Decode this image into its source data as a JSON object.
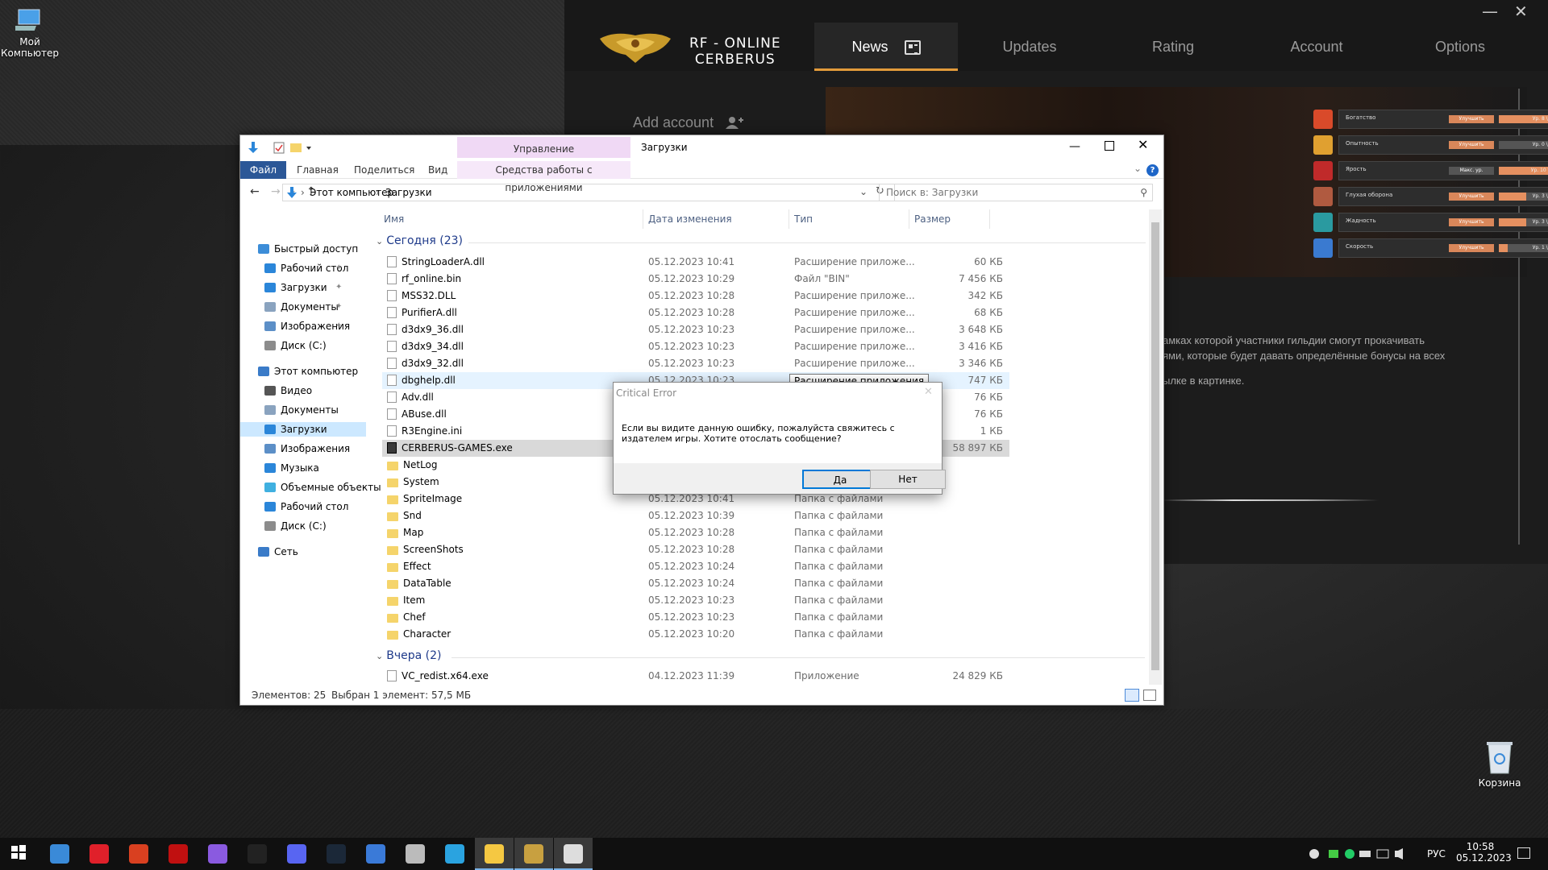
{
  "desktop": {
    "my_computer_label": "Мой Компьютер",
    "recycle_bin_label": "Корзина"
  },
  "launcher": {
    "brand_line1": "RF - ONLINE",
    "brand_line2": "CERBERUS",
    "tabs": [
      {
        "label": "News",
        "active": true
      },
      {
        "label": "Updates",
        "active": false
      },
      {
        "label": "Rating",
        "active": false
      },
      {
        "label": "Account",
        "active": false
      },
      {
        "label": "Options",
        "active": false
      }
    ],
    "minimize": "—",
    "close": "✕",
    "add_account": "Add account",
    "news_lines": [
      "амках которой участники гильдии смогут прокачивать",
      "ями, которые будет давать определённые бонусы на всех",
      "",
      "ылке в картинке."
    ],
    "stats": [
      {
        "name": "Богатство",
        "btn": "Улучшить",
        "level": "Ур. 8 \\ 10",
        "progress": 0.8,
        "color": "#d94a2a"
      },
      {
        "name": "Опытность",
        "btn": "Улучшить",
        "level": "Ур. 0 \\ 10",
        "progress": 0.0,
        "color": "#e0a030"
      },
      {
        "name": "Ярость",
        "btn": "Макс. ур.",
        "level": "Ур. 10 \\ 10",
        "progress": 1.0,
        "color": "#c02a2a"
      },
      {
        "name": "Глухая оборона",
        "btn": "Улучшить",
        "level": "Ур. 3 \\ 10",
        "progress": 0.3,
        "color": "#b05a40"
      },
      {
        "name": "Жадность",
        "btn": "Улучшить",
        "level": "Ур. 3 \\ 10",
        "progress": 0.3,
        "color": "#2a9aa0"
      },
      {
        "name": "Скорость",
        "btn": "Улучшить",
        "level": "Ур. 1 \\ 10",
        "progress": 0.1,
        "color": "#3a7ad0"
      }
    ]
  },
  "explorer": {
    "title": "Загрузки",
    "manage_tab": "Управление",
    "ribbon_tabs": [
      "Файл",
      "Главная",
      "Поделиться",
      "Вид",
      "Средства работы с приложениями"
    ],
    "address": [
      "Этот компьютер",
      "Загрузки"
    ],
    "search_placeholder": "Поиск в: Загрузки",
    "nav": [
      {
        "label": "Быстрый доступ",
        "color": "#3c8dd8",
        "indent": 0
      },
      {
        "label": "Рабочий стол",
        "color": "#2b86d9",
        "indent": 1,
        "pin": true
      },
      {
        "label": "Загрузки",
        "color": "#2b86d9",
        "indent": 1,
        "pin": true
      },
      {
        "label": "Документы",
        "color": "#8aa3bf",
        "indent": 1,
        "pin": true
      },
      {
        "label": "Изображения",
        "color": "#5c8fc7",
        "indent": 1,
        "pin": true
      },
      {
        "label": "Диск (C:)",
        "color": "#8c8c8c",
        "indent": 1
      },
      {
        "label": "Этот компьютер",
        "color": "#3a7bc8",
        "indent": 0
      },
      {
        "label": "Видео",
        "color": "#555",
        "indent": 1
      },
      {
        "label": "Документы",
        "color": "#8aa3bf",
        "indent": 1
      },
      {
        "label": "Загрузки",
        "color": "#2b86d9",
        "indent": 1,
        "selected": true
      },
      {
        "label": "Изображения",
        "color": "#5c8fc7",
        "indent": 1
      },
      {
        "label": "Музыка",
        "color": "#2b86d9",
        "indent": 1
      },
      {
        "label": "Объемные объекты",
        "color": "#40b0e0",
        "indent": 1
      },
      {
        "label": "Рабочий стол",
        "color": "#2b86d9",
        "indent": 1
      },
      {
        "label": "Диск (C:)",
        "color": "#8c8c8c",
        "indent": 1
      },
      {
        "label": "Сеть",
        "color": "#3a7bc8",
        "indent": 0
      }
    ],
    "columns": [
      "Имя",
      "Дата изменения",
      "Тип",
      "Размер"
    ],
    "group_today": "Сегодня (23)",
    "group_yesterday": "Вчера (2)",
    "files": [
      {
        "name": "StringLoaderA.dll",
        "date": "05.12.2023 10:41",
        "type": "Расширение приложе...",
        "size": "60 КБ",
        "icon": "dll"
      },
      {
        "name": "rf_online.bin",
        "date": "05.12.2023 10:29",
        "type": "Файл \"BIN\"",
        "size": "7 456 КБ",
        "icon": "bin"
      },
      {
        "name": "MSS32.DLL",
        "date": "05.12.2023 10:28",
        "type": "Расширение приложе...",
        "size": "342 КБ",
        "icon": "dll"
      },
      {
        "name": "PurifierA.dll",
        "date": "05.12.2023 10:28",
        "type": "Расширение приложе...",
        "size": "68 КБ",
        "icon": "dll"
      },
      {
        "name": "d3dx9_36.dll",
        "date": "05.12.2023 10:23",
        "type": "Расширение приложе...",
        "size": "3 648 КБ",
        "icon": "dll"
      },
      {
        "name": "d3dx9_34.dll",
        "date": "05.12.2023 10:23",
        "type": "Расширение приложе...",
        "size": "3 416 КБ",
        "icon": "dll"
      },
      {
        "name": "d3dx9_32.dll",
        "date": "05.12.2023 10:23",
        "type": "Расширение приложе...",
        "size": "3 346 КБ",
        "icon": "dll"
      },
      {
        "name": "dbghelp.dll",
        "date": "05.12.2023 10:23",
        "type": "",
        "size": "747 КБ",
        "icon": "dll",
        "hover": true
      },
      {
        "name": "Adv.dll",
        "date": "",
        "type": "",
        "size": "76 КБ",
        "icon": "dll"
      },
      {
        "name": "ABuse.dll",
        "date": "",
        "type": "",
        "size": "76 КБ",
        "icon": "dll"
      },
      {
        "name": "R3Engine.ini",
        "date": "",
        "type": "",
        "size": "1 КБ",
        "icon": "bin"
      },
      {
        "name": "CERBERUS-GAMES.exe",
        "date": "",
        "type": "",
        "size": "58 897 КБ",
        "icon": "exe",
        "selected": true
      },
      {
        "name": "NetLog",
        "date": "",
        "type": "",
        "size": "",
        "icon": "folder"
      },
      {
        "name": "System",
        "date": "",
        "type": "",
        "size": "",
        "icon": "folder"
      },
      {
        "name": "SpriteImage",
        "date": "05.12.2023 10:41",
        "type": "Папка с файлами",
        "size": "",
        "icon": "folder"
      },
      {
        "name": "Snd",
        "date": "05.12.2023 10:39",
        "type": "Папка с файлами",
        "size": "",
        "icon": "folder"
      },
      {
        "name": "Map",
        "date": "05.12.2023 10:28",
        "type": "Папка с файлами",
        "size": "",
        "icon": "folder"
      },
      {
        "name": "ScreenShots",
        "date": "05.12.2023 10:28",
        "type": "Папка с файлами",
        "size": "",
        "icon": "folder"
      },
      {
        "name": "Effect",
        "date": "05.12.2023 10:24",
        "type": "Папка с файлами",
        "size": "",
        "icon": "folder"
      },
      {
        "name": "DataTable",
        "date": "05.12.2023 10:24",
        "type": "Папка с файлами",
        "size": "",
        "icon": "folder"
      },
      {
        "name": "Item",
        "date": "05.12.2023 10:23",
        "type": "Папка с файлами",
        "size": "",
        "icon": "folder"
      },
      {
        "name": "Chef",
        "date": "05.12.2023 10:23",
        "type": "Папка с файлами",
        "size": "",
        "icon": "folder"
      },
      {
        "name": "Character",
        "date": "05.12.2023 10:20",
        "type": "Папка с файлами",
        "size": "",
        "icon": "folder"
      }
    ],
    "yesterday_files": [
      {
        "name": "VC_redist.x64.exe",
        "date": "04.12.2023 11:39",
        "type": "Приложение",
        "size": "24 829 КБ",
        "icon": "bin"
      }
    ],
    "status_count": "Элементов: 25",
    "status_selected": "Выбран 1 элемент: 57,5 МБ",
    "tooltip": "Расширение приложения"
  },
  "dialog": {
    "title": "Critical Error",
    "message": "Если вы видите данную ошибку, пожалуйста свяжитесь с издателем игры. Хотите отослать сообщение?",
    "yes": "Да",
    "no": "Нет"
  },
  "taskbar": {
    "apps": [
      {
        "name": "windows-start",
        "color": "#ffffff"
      },
      {
        "name": "my-computer",
        "color": "#3a8ad8"
      },
      {
        "name": "opera",
        "color": "#e0202a"
      },
      {
        "name": "ccleaner",
        "color": "#d94020"
      },
      {
        "name": "bloody",
        "color": "#c01010"
      },
      {
        "name": "twitch",
        "color": "#8a5ae0"
      },
      {
        "name": "epic-games",
        "color": "#222222"
      },
      {
        "name": "discord",
        "color": "#5865f2"
      },
      {
        "name": "steam",
        "color": "#1b2838"
      },
      {
        "name": "browser",
        "color": "#3a7ad8"
      },
      {
        "name": "roblox",
        "color": "#bbbbbb"
      },
      {
        "name": "telegram",
        "color": "#2aa3e0"
      },
      {
        "name": "file-explorer",
        "color": "#f5c842"
      },
      {
        "name": "cerberus",
        "color": "#c8a040"
      },
      {
        "name": "cerberus2",
        "color": "#dddddd"
      }
    ],
    "lang": "РУС",
    "time": "10:58",
    "date": "05.12.2023"
  }
}
